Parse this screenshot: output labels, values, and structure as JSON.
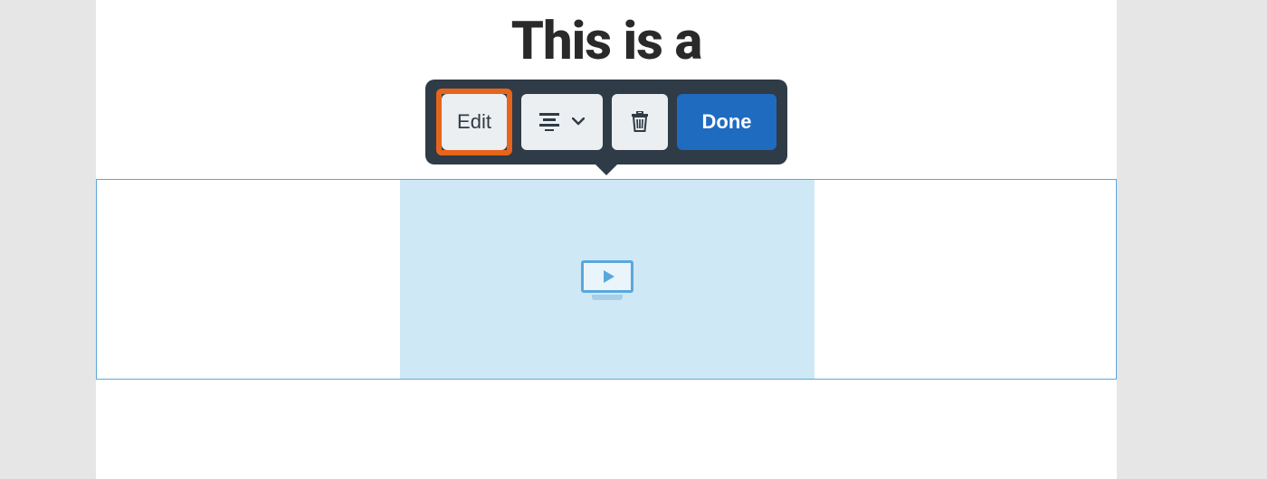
{
  "title": "This is a",
  "toolbar": {
    "edit_label": "Edit",
    "done_label": "Done"
  }
}
